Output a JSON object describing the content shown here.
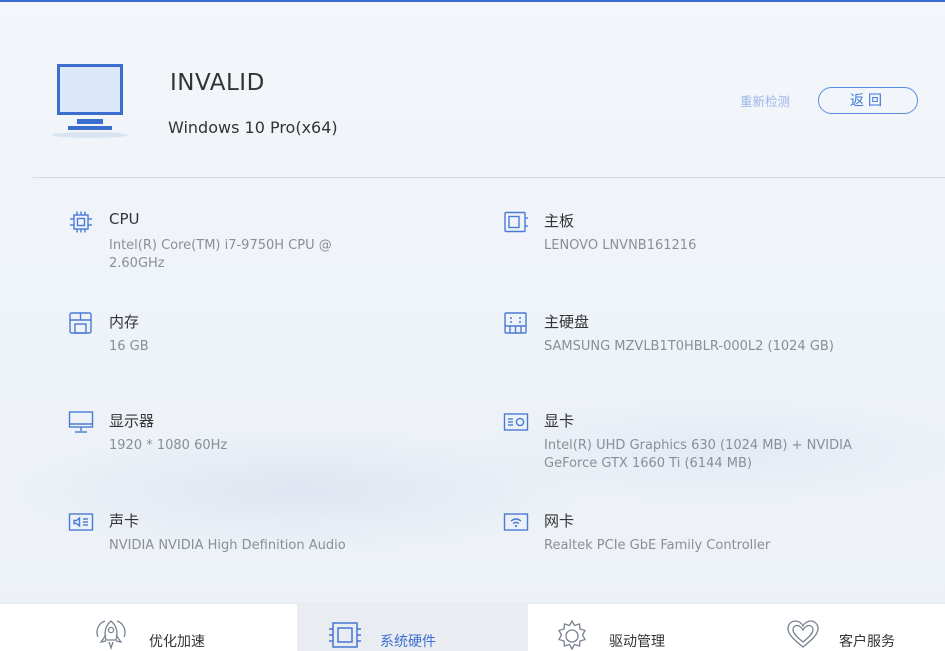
{
  "header": {
    "device_name": "INVALID",
    "os": "Windows 10 Pro(x64)",
    "redetect_label": "重新检测",
    "back_label": "返回"
  },
  "hardware": [
    {
      "title": "CPU",
      "value": "Intel(R) Core(TM) i7-9750H CPU @ 2.60GHz",
      "icon": "cpu-icon"
    },
    {
      "title": "主板",
      "value": "LENOVO LNVNB161216",
      "icon": "motherboard-icon"
    },
    {
      "title": "内存",
      "value": "16 GB",
      "icon": "memory-icon"
    },
    {
      "title": "主硬盘",
      "value": "SAMSUNG MZVLB1T0HBLR-000L2 (1024 GB)",
      "icon": "hard-disk-icon"
    },
    {
      "title": "显示器",
      "value": "1920 * 1080  60Hz",
      "icon": "monitor-icon"
    },
    {
      "title": "显卡",
      "value": "Intel(R) UHD Graphics 630 (1024 MB) + NVIDIA GeForce GTX 1660 Ti (6144 MB)",
      "icon": "graphics-card-icon"
    },
    {
      "title": "声卡",
      "value": "NVIDIA NVIDIA High Definition Audio",
      "icon": "sound-card-icon"
    },
    {
      "title": "网卡",
      "value": "Realtek PCIe GbE Family Controller",
      "icon": "network-card-icon"
    }
  ],
  "nav": [
    {
      "label": "优化加速",
      "icon": "rocket-icon",
      "active": false
    },
    {
      "label": "系统硬件",
      "icon": "chip-icon",
      "active": true
    },
    {
      "label": "驱动管理",
      "icon": "gear-icon",
      "active": false
    },
    {
      "label": "客户服务",
      "icon": "heart-icon",
      "active": false
    }
  ],
  "colors": {
    "accent": "#3d78dc",
    "top_line": "#3b6fcf",
    "title_text": "#333333",
    "value_text": "#8a8f96"
  }
}
